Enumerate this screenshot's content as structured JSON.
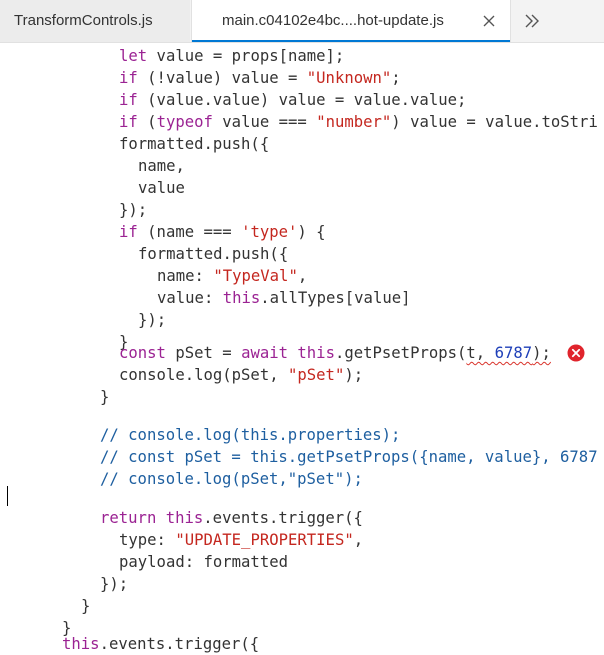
{
  "tabs": [
    {
      "label": "TransformControls.js"
    },
    {
      "label": "main.c04102e4bc....hot-update.js",
      "active": true
    }
  ],
  "icons": {
    "tab_close": "close-icon",
    "overflow": "chevron-double-right-icon",
    "error": "error-icon"
  },
  "colors": {
    "keyword": "#9b2393",
    "string": "#c4271f",
    "number": "#1e3fb8",
    "comment": "#1e5fa0",
    "accent": "#0078d4",
    "error": "#e0242c"
  },
  "code": {
    "l1": {
      "a": "let",
      "b": " value = props[name];"
    },
    "l2": {
      "a": "if",
      "b": " (!value) value = ",
      "c": "\"Unknown\"",
      "d": ";"
    },
    "l3": {
      "a": "if",
      "b": " (value.value) value = value.value;"
    },
    "l4": {
      "a": "if",
      "b": " (",
      "c": "typeof",
      "d": " value === ",
      "e": "\"number\"",
      "f": ") value = value.toStri"
    },
    "l5": {
      "a": "formatted.push({"
    },
    "l6": {
      "a": "name,"
    },
    "l7": {
      "a": "value"
    },
    "l8": {
      "a": "});"
    },
    "l9": {
      "a": "if",
      "b": " (name === ",
      "c": "'type'",
      "d": ") {"
    },
    "l10": {
      "a": "formatted.push({"
    },
    "l11": {
      "a": "name: ",
      "b": "\"TypeVal\"",
      "c": ","
    },
    "l12": {
      "a": "value: ",
      "b": "this",
      "c": ".allTypes[value]"
    },
    "l13": {
      "a": "});"
    },
    "l14": {
      "a": "}"
    },
    "l15": {
      "a": "const",
      "b": " pSet = ",
      "c": "await",
      "d": " ",
      "e": "this",
      "f": ".getPsetProps(",
      "g": "t, ",
      "h": "6787",
      "i": ");"
    },
    "l16": {
      "a": "console.log(pSet, ",
      "b": "\"pSet\"",
      "c": ");"
    },
    "l17": {
      "a": "}"
    },
    "l18": {
      "a": "// console.log(this.properties);"
    },
    "l19": {
      "a": "// const pSet = this.getPsetProps({name, value}, 6787"
    },
    "l20": {
      "a": "// console.log(pSet,\"pSet\");"
    },
    "l21": {
      "a": "return",
      "b": " ",
      "c": "this",
      "d": ".events.trigger({"
    },
    "l22": {
      "a": "type: ",
      "b": "\"UPDATE_PROPERTIES\"",
      "c": ","
    },
    "l23": {
      "a": "payload: formatted"
    },
    "l24": {
      "a": "});"
    },
    "l25": {
      "a": "}"
    },
    "l26": {
      "a": "}"
    },
    "l27": {
      "a": "this",
      "b": ".events.trigger({"
    }
  }
}
